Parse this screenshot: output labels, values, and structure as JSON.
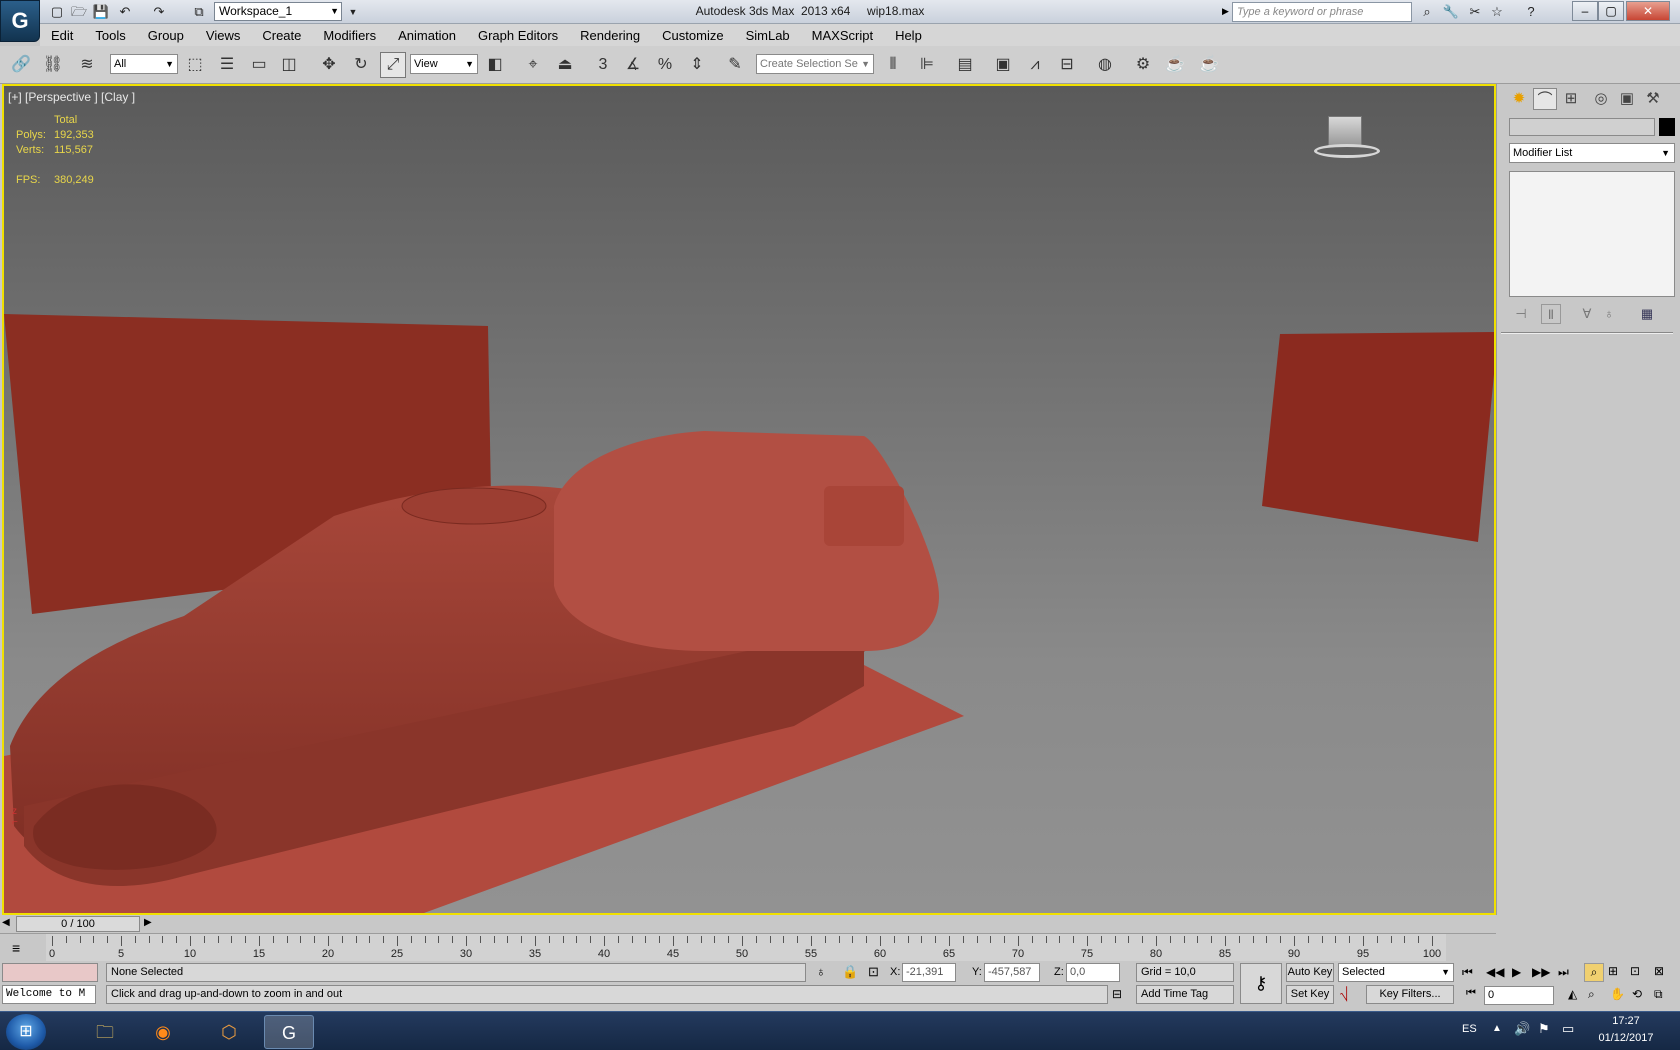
{
  "titlebar": {
    "workspace": "Workspace_1",
    "title": "Autodesk 3ds Max  2013 x64     wip18.max",
    "search_placeholder": "Type a keyword or phrase"
  },
  "menus": [
    "Edit",
    "Tools",
    "Group",
    "Views",
    "Create",
    "Modifiers",
    "Animation",
    "Graph Editors",
    "Rendering",
    "Customize",
    "SimLab",
    "MAXScript",
    "Help"
  ],
  "toolbar": {
    "filter": "All",
    "ref_coord": "View",
    "selection_set_placeholder": "Create Selection Se",
    "snap_label": "3"
  },
  "viewport": {
    "label": "[+] [Perspective ] [Clay ]",
    "stats_header": "Total",
    "polys_label": "Polys:",
    "polys": "192,353",
    "verts_label": "Verts:",
    "verts": "115,567",
    "fps_label": "FPS:",
    "fps": "380,249",
    "model_color": "#9a3a2e"
  },
  "command_panel": {
    "modifier_list": "Modifier List"
  },
  "timeline": {
    "frame": "0 / 100",
    "ticks": [
      "0",
      "5",
      "10",
      "15",
      "20",
      "25",
      "30",
      "35",
      "40",
      "45",
      "50",
      "55",
      "60",
      "65",
      "70",
      "75",
      "80",
      "85",
      "90",
      "95",
      "100"
    ]
  },
  "status": {
    "listener": "Welcome to M",
    "selection": "None Selected",
    "prompt": "Click and drag up-and-down to zoom in and out",
    "x_label": "X:",
    "x": "-21,391",
    "y_label": "Y:",
    "y": "-457,587",
    "z_label": "Z:",
    "z": "0,0",
    "grid": "Grid = 10,0",
    "add_time_tag": "Add Time Tag",
    "auto_key": "Auto Key",
    "set_key": "Set Key",
    "selected": "Selected",
    "key_filters": "Key Filters...",
    "frame_field": "0"
  },
  "taskbar": {
    "lang": "ES",
    "time": "17:27",
    "date": "01/12/2017"
  }
}
